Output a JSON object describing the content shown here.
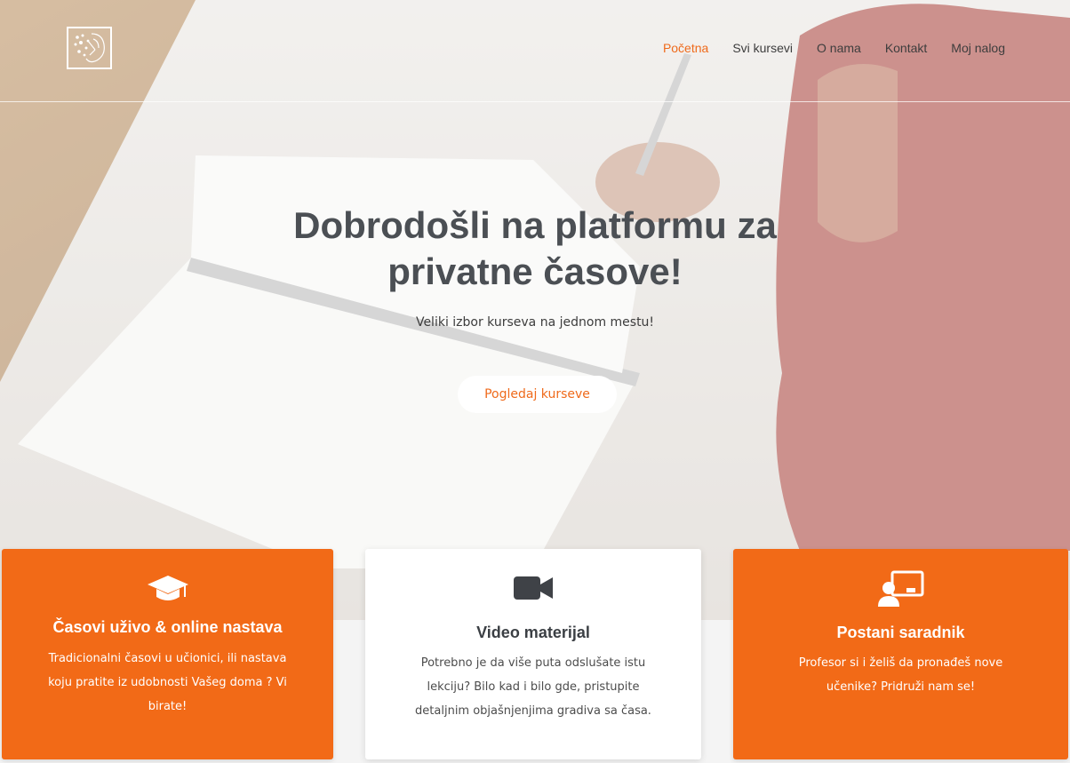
{
  "nav": {
    "items": [
      {
        "label": "Početna",
        "active": true
      },
      {
        "label": "Svi kursevi",
        "active": false
      },
      {
        "label": "O nama",
        "active": false
      },
      {
        "label": "Kontakt",
        "active": false
      },
      {
        "label": "Moj nalog",
        "active": false
      }
    ]
  },
  "hero": {
    "title_line1": "Dobrodošli na platformu za",
    "title_line2": "privatne časove!",
    "subtitle": "Veliki izbor kurseva na jednom mestu!",
    "button": "Pogledaj kurseve"
  },
  "cards": [
    {
      "icon": "graduation-cap-icon",
      "title": "Časovi uživo & online nastava",
      "text": "Tradicionalni časovi u učionici, ili nastava koju pratite iz udobnosti Vašeg doma ? Vi birate!"
    },
    {
      "icon": "video-camera-icon",
      "title": "Video materijal",
      "text": "Potrebno je da više puta odslušate istu lekciju? Bilo kad i bilo gde, pristupite detaljnim objašnjenjima gradiva sa časa."
    },
    {
      "icon": "teacher-board-icon",
      "title": "Postani saradnik",
      "text": "Profesor si i želiš da pronađeš nove učenike? Pridruži nam se!"
    }
  ],
  "colors": {
    "accent": "#f26a17",
    "title_text": "#4b4f54"
  }
}
